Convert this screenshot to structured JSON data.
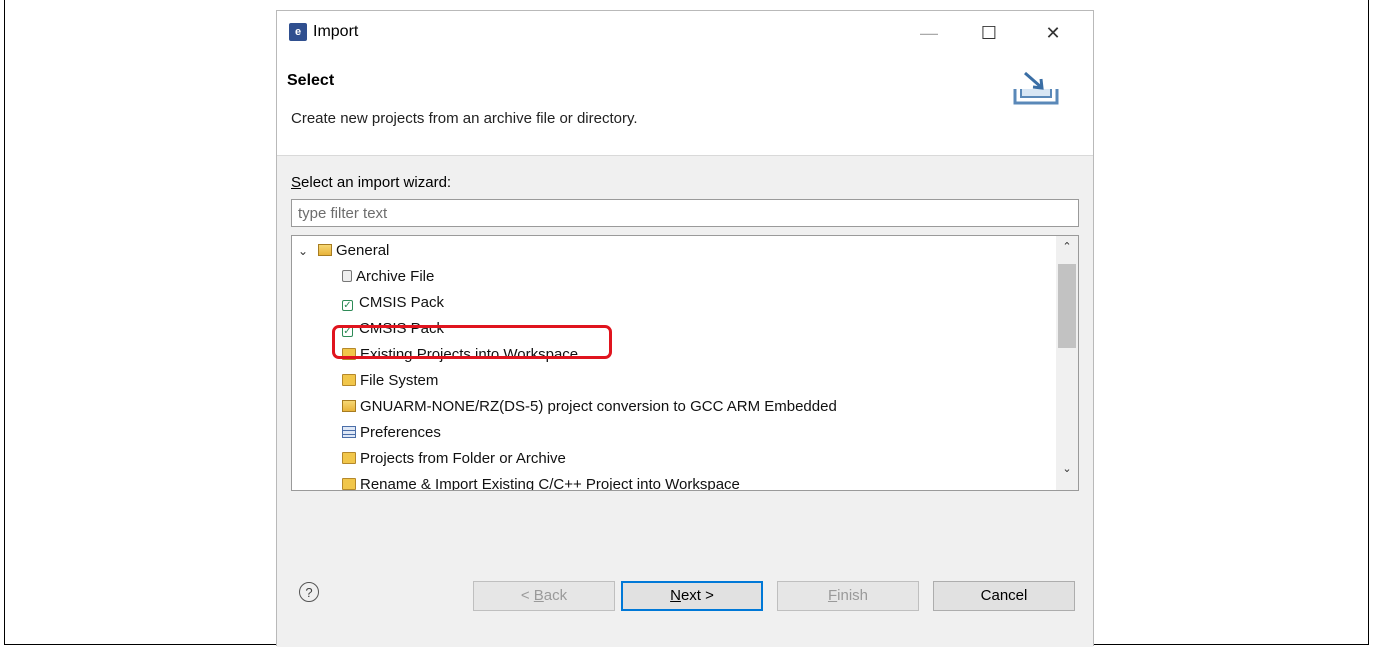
{
  "window": {
    "title": "Import",
    "app_icon": "eclipse-app-icon"
  },
  "banner": {
    "title": "Select",
    "description": "Create new projects from an archive file or directory.",
    "icon": "import-wizard-icon"
  },
  "wizard": {
    "label": "Select an import wizard:",
    "label_mnemonic": "S",
    "label_rest": "elect an import wizard:",
    "filter_placeholder": "type filter text"
  },
  "tree": {
    "group": "General",
    "items": [
      {
        "label": "Archive File",
        "icon": "archive-file-icon"
      },
      {
        "label": "CMSIS Pack",
        "icon": "cmsis-pack-icon"
      },
      {
        "label": "CMSIS Pack",
        "icon": "cmsis-pack-icon"
      },
      {
        "label": "Existing Projects into Workspace",
        "icon": "existing-project-icon",
        "highlighted": true
      },
      {
        "label": "File System",
        "icon": "folder-icon"
      },
      {
        "label": "GNUARM-NONE/RZ(DS-5)  project conversion to GCC ARM Embedded",
        "icon": "open-folder-icon"
      },
      {
        "label": "Preferences",
        "icon": "preferences-icon"
      },
      {
        "label": "Projects from Folder or Archive",
        "icon": "folder-icon"
      },
      {
        "label": "Rename & Import Existing C/C++ Project into Workspace",
        "icon": "existing-project-icon"
      }
    ]
  },
  "buttons": {
    "back": "< Back",
    "back_mn": "B",
    "back_pre": "< ",
    "back_rest": "ack",
    "next": "Next >",
    "next_mn": "N",
    "next_rest": "ext >",
    "finish": "Finish",
    "finish_mn": "F",
    "finish_rest": "inish",
    "cancel": "Cancel"
  },
  "colors": {
    "highlight": "#e0141e",
    "default_button_border": "#0078d7"
  }
}
